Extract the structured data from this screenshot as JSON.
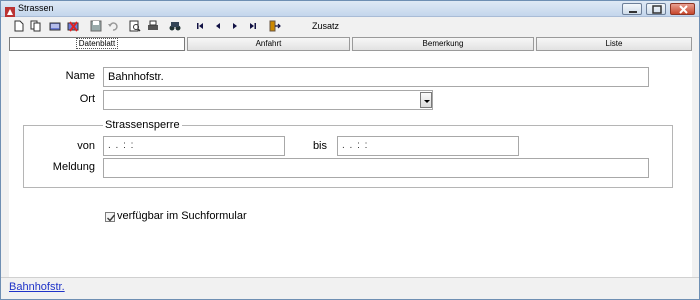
{
  "window": {
    "title": "Strassen"
  },
  "toolbar": {
    "icons": [
      "new-icon",
      "copy-icon",
      "edit-icon",
      "delete-icon",
      "save-icon",
      "undo-icon",
      "preview-icon",
      "print-icon",
      "binoculars-icon",
      "first-record-icon",
      "prev-record-icon",
      "next-record-icon",
      "last-record-icon",
      "exit-icon"
    ],
    "extra_label": "Zusatz"
  },
  "tabs": [
    {
      "label": "Datenblatt",
      "active": true
    },
    {
      "label": "Anfahrt",
      "active": false
    },
    {
      "label": "Bemerkung",
      "active": false
    },
    {
      "label": "Liste",
      "active": false
    }
  ],
  "form": {
    "name_label": "Name",
    "name_value": "Bahnhofstr.",
    "ort_label": "Ort",
    "ort_value": "",
    "group_title": "Strassensperre",
    "von_label": "von",
    "von_value": ". .    : :",
    "bis_label": "bis",
    "bis_value": ". .    : :",
    "meldung_label": "Meldung",
    "meldung_value": "",
    "checkbox_label": "verfügbar im Suchformular",
    "checkbox_checked": true
  },
  "status": {
    "link_text": "Bahnhofstr."
  },
  "colors": {
    "link": "#1f33c8",
    "titlebar": "#c4d6ec",
    "close_button": "#c7472c"
  }
}
